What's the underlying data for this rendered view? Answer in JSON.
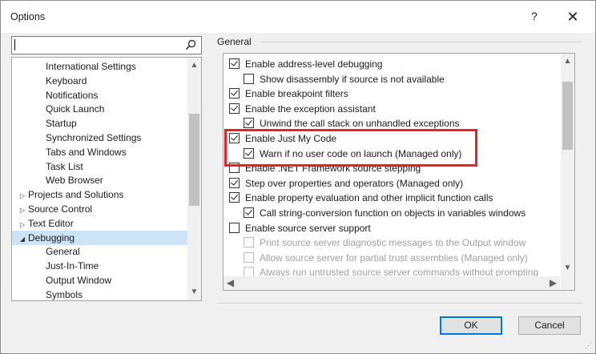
{
  "window": {
    "title": "Options",
    "help_label": "?",
    "close_label": "✕"
  },
  "search": {
    "value": "",
    "placeholder": ""
  },
  "tree": {
    "items": [
      {
        "label": "International Settings",
        "indent": 2,
        "expander": ""
      },
      {
        "label": "Keyboard",
        "indent": 2,
        "expander": ""
      },
      {
        "label": "Notifications",
        "indent": 2,
        "expander": ""
      },
      {
        "label": "Quick Launch",
        "indent": 2,
        "expander": ""
      },
      {
        "label": "Startup",
        "indent": 2,
        "expander": ""
      },
      {
        "label": "Synchronized Settings",
        "indent": 2,
        "expander": ""
      },
      {
        "label": "Tabs and Windows",
        "indent": 2,
        "expander": ""
      },
      {
        "label": "Task List",
        "indent": 2,
        "expander": ""
      },
      {
        "label": "Web Browser",
        "indent": 2,
        "expander": ""
      },
      {
        "label": "Projects and Solutions",
        "indent": 1,
        "expander": "▷"
      },
      {
        "label": "Source Control",
        "indent": 1,
        "expander": "▷"
      },
      {
        "label": "Text Editor",
        "indent": 1,
        "expander": "▷"
      },
      {
        "label": "Debugging",
        "indent": 1,
        "expander": "◢",
        "selected": true
      },
      {
        "label": "General",
        "indent": 2,
        "expander": ""
      },
      {
        "label": "Just-In-Time",
        "indent": 2,
        "expander": ""
      },
      {
        "label": "Output Window",
        "indent": 2,
        "expander": ""
      },
      {
        "label": "Symbols",
        "indent": 2,
        "expander": ""
      }
    ]
  },
  "panel": {
    "group_label": "General",
    "options": [
      {
        "label": "Enable address-level debugging",
        "checked": true,
        "level": 0,
        "disabled": false
      },
      {
        "label": "Show disassembly if source is not available",
        "checked": false,
        "level": 1,
        "disabled": false
      },
      {
        "label": "Enable breakpoint filters",
        "checked": true,
        "level": 0,
        "disabled": false
      },
      {
        "label": "Enable the exception assistant",
        "checked": true,
        "level": 0,
        "disabled": false
      },
      {
        "label": "Unwind the call stack on unhandled exceptions",
        "checked": true,
        "level": 1,
        "disabled": false
      },
      {
        "label": "Enable Just My Code",
        "checked": true,
        "level": 0,
        "disabled": false
      },
      {
        "label": "Warn if no user code on launch (Managed only)",
        "checked": true,
        "level": 1,
        "disabled": false
      },
      {
        "label": "Enable .NET Framework source stepping",
        "checked": false,
        "level": 0,
        "disabled": false
      },
      {
        "label": "Step over properties and operators (Managed only)",
        "checked": true,
        "level": 0,
        "disabled": false
      },
      {
        "label": "Enable property evaluation and other implicit function calls",
        "checked": true,
        "level": 0,
        "disabled": false
      },
      {
        "label": "Call string-conversion function on objects in variables windows",
        "checked": true,
        "level": 1,
        "disabled": false
      },
      {
        "label": "Enable source server support",
        "checked": false,
        "level": 0,
        "disabled": false
      },
      {
        "label": "Print source server diagnostic messages to the Output window",
        "checked": false,
        "level": 1,
        "disabled": true
      },
      {
        "label": "Allow source server for partial trust assemblies (Managed only)",
        "checked": false,
        "level": 1,
        "disabled": true
      },
      {
        "label": "Always run untrusted source server commands without prompting",
        "checked": false,
        "level": 1,
        "disabled": true
      }
    ]
  },
  "buttons": {
    "ok": "OK",
    "cancel": "Cancel"
  },
  "colors": {
    "highlight": "#e8202a",
    "selection": "#cce4f7",
    "focus": "#0078d7"
  }
}
